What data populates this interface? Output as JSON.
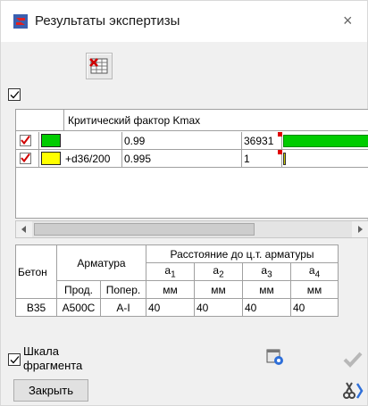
{
  "window": {
    "title": "Результаты экспертизы",
    "close_label": "×"
  },
  "toolbar": {
    "icon": "table-delete-icon"
  },
  "top_check": {
    "checked": true
  },
  "grid": {
    "header": "Критический фактор Kmax",
    "rows": [
      {
        "checked": true,
        "color": "#00cc00",
        "name": "",
        "factor": "0.99",
        "count": "36931",
        "bar_color": "#00cc00",
        "bar_fraction": 1.0
      },
      {
        "checked": true,
        "color": "#ffff00",
        "name": "+d36/200",
        "factor": "0.995",
        "count": "1",
        "bar_color": "#c8c800",
        "bar_fraction": 0.03
      }
    ]
  },
  "scroll": {
    "left_arrow": "◀",
    "right_arrow": "▶"
  },
  "table": {
    "beton": "Бетон",
    "armatura": "Арматура",
    "rasst": "Расстояние до ц.т. арматуры",
    "a1": "a",
    "a1s": "1",
    "a2": "a",
    "a2s": "2",
    "a3": "a",
    "a3s": "3",
    "a4": "a",
    "a4s": "4",
    "prod": "Прод.",
    "poper": "Попер.",
    "mm": "мм",
    "row": {
      "beton": "B35",
      "prod": "A500C",
      "poper": "A-I",
      "a1": "40",
      "a2": "40",
      "a3": "40",
      "a4": "40"
    }
  },
  "scale": {
    "label_line1": "Шкала",
    "label_line2": "фрагмента",
    "checked": true
  },
  "buttons": {
    "close": "Закрыть"
  },
  "colors": {
    "accent_red": "#cc0000",
    "green": "#00cc00",
    "yellow": "#ffff00"
  }
}
